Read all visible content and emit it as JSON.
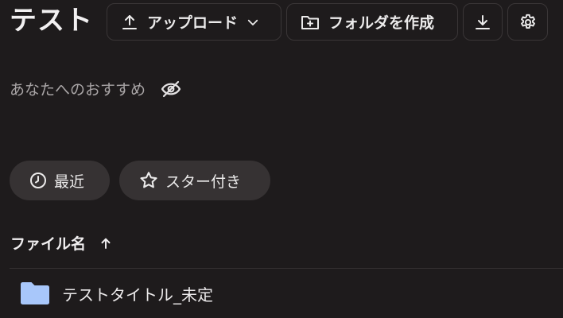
{
  "header": {
    "title": "テスト",
    "upload_label": "アップロード",
    "create_folder_label": "フォルダを作成"
  },
  "recommendations": {
    "label": "あなたへのおすすめ"
  },
  "filters": {
    "recent_label": "最近",
    "starred_label": "スター付き"
  },
  "file_list": {
    "name_column_label": "ファイル名",
    "items": [
      {
        "name": "テストタイトル_未定",
        "type": "folder"
      }
    ]
  },
  "colors": {
    "background": "#1e1b1c",
    "chip_background": "#363233",
    "folder": "#a8c7fa",
    "muted_text": "#a9a5a6"
  },
  "icons": {
    "upload": "upload-icon",
    "chevron": "chevron-down-icon",
    "create_folder": "folder-plus-icon",
    "download": "download-icon",
    "settings": "gear-icon",
    "hide": "eye-off-icon",
    "recent": "clock-icon",
    "starred": "star-icon",
    "sort": "arrow-up-icon",
    "folder": "folder-icon"
  }
}
